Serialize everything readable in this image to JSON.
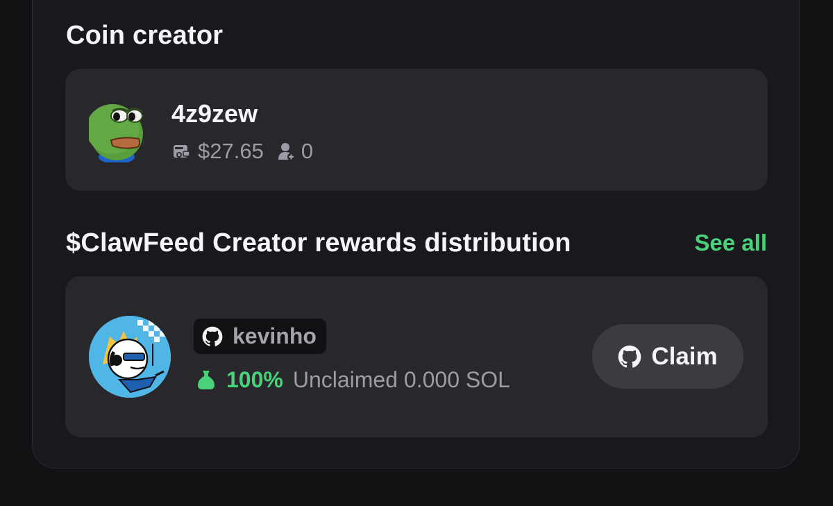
{
  "creator_section": {
    "title": "Coin creator",
    "name": "4z9zew",
    "balance": "$27.65",
    "followers": "0",
    "icons": {
      "wallet": "wallet-icon",
      "followers": "user-plus-icon"
    }
  },
  "rewards_section": {
    "title": "$ClawFeed Creator rewards distribution",
    "see_all_label": "See all",
    "recipient": {
      "github_handle": "kevinho",
      "percent": "100%",
      "unclaimed": "Unclaimed 0.000 SOL"
    },
    "claim_label": "Claim",
    "icons": {
      "github": "github-icon",
      "money_bag": "money-bag-icon"
    }
  },
  "colors": {
    "accent_green": "#4ad27a",
    "card_bg": "#27272c",
    "panel_bg": "#19191d",
    "page_bg": "#121215"
  }
}
